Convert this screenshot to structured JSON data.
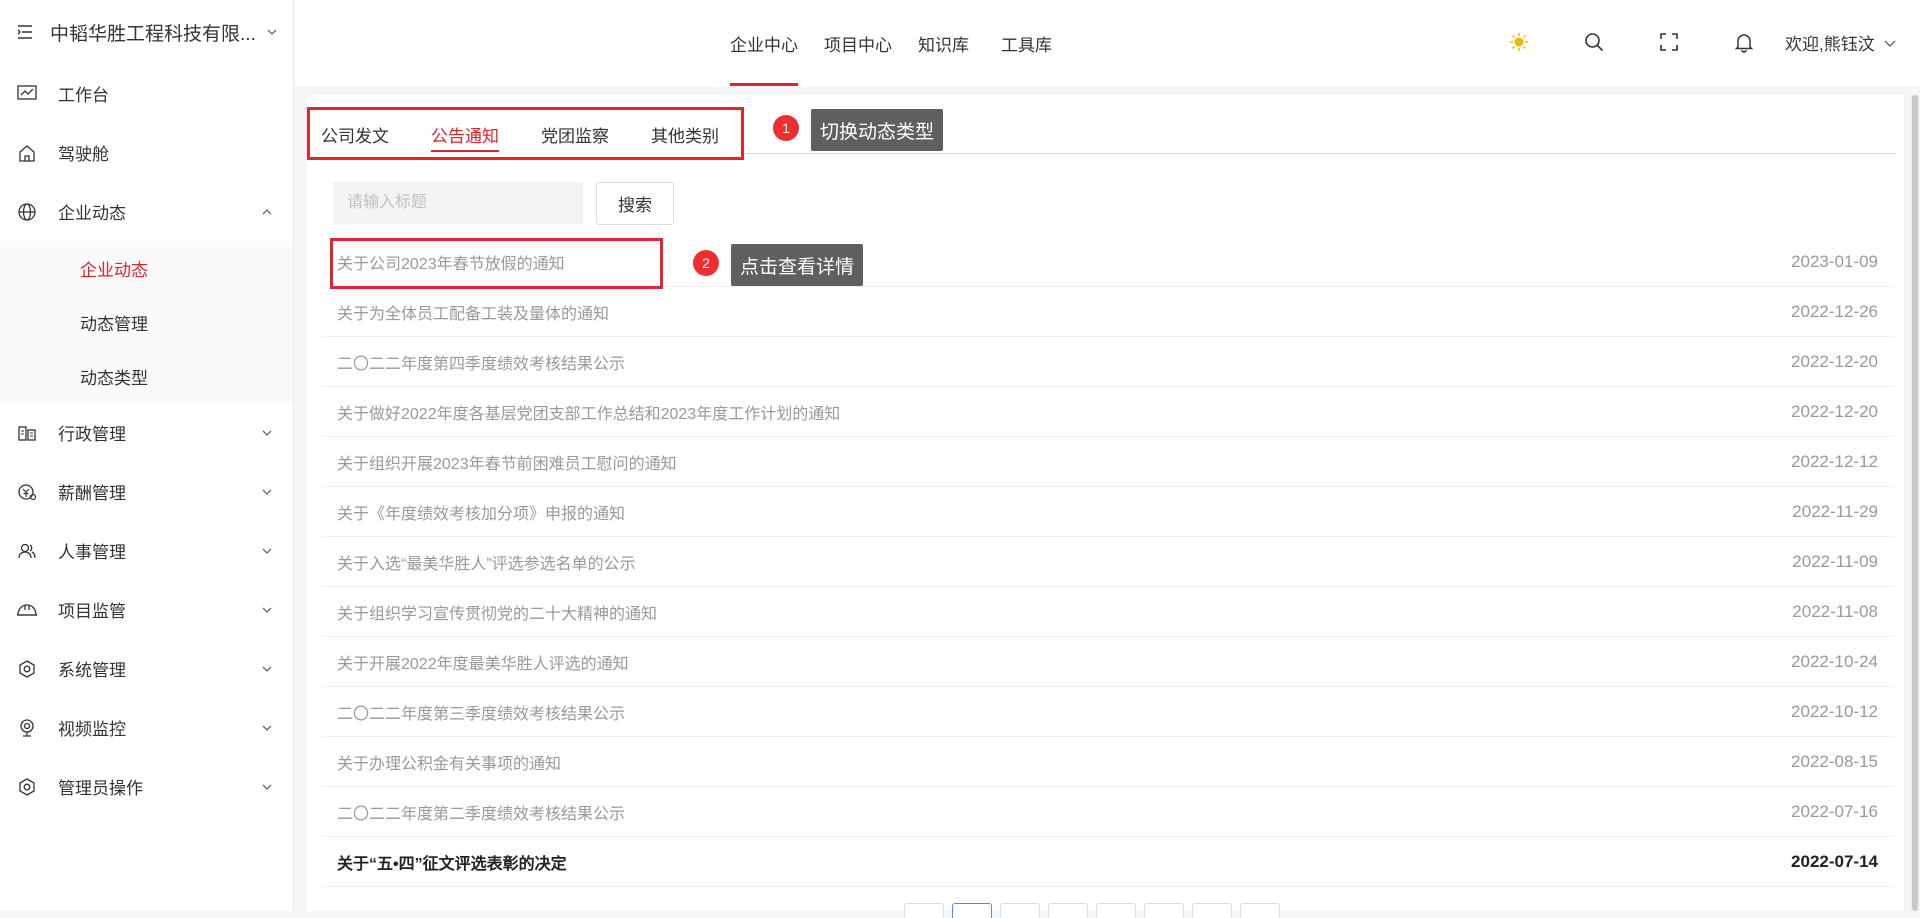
{
  "sidebar": {
    "company": "中韬华胜工程科技有限...",
    "items": [
      {
        "label": "工作台",
        "icon": "monitor-chart-icon"
      },
      {
        "label": "驾驶舱",
        "icon": "home-icon"
      },
      {
        "label": "企业动态",
        "icon": "globe-icon",
        "expanded": true
      }
    ],
    "sub_items": [
      {
        "label": "企业动态",
        "active": true
      },
      {
        "label": "动态管理"
      },
      {
        "label": "动态类型"
      }
    ],
    "items_after": [
      {
        "label": "行政管理",
        "icon": "building-icon"
      },
      {
        "label": "薪酬管理",
        "icon": "salary-icon"
      },
      {
        "label": "人事管理",
        "icon": "people-icon"
      },
      {
        "label": "项目监管",
        "icon": "helmet-icon"
      },
      {
        "label": "系统管理",
        "icon": "gear-icon"
      },
      {
        "label": "视频监控",
        "icon": "camera-icon"
      },
      {
        "label": "管理员操作",
        "icon": "gear-icon"
      }
    ]
  },
  "topnav": {
    "items": [
      {
        "label": "企业中心",
        "active": true
      },
      {
        "label": "项目中心"
      },
      {
        "label": "知识库"
      },
      {
        "label": "工具库"
      }
    ],
    "welcome": "欢迎,熊钰汶"
  },
  "tabs": [
    {
      "label": "公司发文"
    },
    {
      "label": "公告通知",
      "active": true
    },
    {
      "label": "党团监察"
    },
    {
      "label": "其他类别"
    }
  ],
  "annotations": {
    "one_num": "1",
    "one_text": "切换动态类型",
    "two_num": "2",
    "two_text": "点击查看详情"
  },
  "search": {
    "placeholder": "请输入标题",
    "button": "搜索"
  },
  "notices": [
    {
      "title": "关于公司2023年春节放假的通知",
      "date": "2023-01-09"
    },
    {
      "title": "关于为全体员工配备工装及量体的通知",
      "date": "2022-12-26"
    },
    {
      "title": "二〇二二年度第四季度绩效考核结果公示",
      "date": "2022-12-20"
    },
    {
      "title": "关于做好2022年度各基层党团支部工作总结和2023年度工作计划的通知",
      "date": "2022-12-20"
    },
    {
      "title": "关于组织开展2023年春节前困难员工慰问的通知",
      "date": "2022-12-12"
    },
    {
      "title": "关于《年度绩效考核加分项》申报的通知",
      "date": "2022-11-29"
    },
    {
      "title": "关于入选“最美华胜人”评选参选名单的公示",
      "date": "2022-11-09"
    },
    {
      "title": "关于组织学习宣传贯彻党的二十大精神的通知",
      "date": "2022-11-08"
    },
    {
      "title": "关于开展2022年度最美华胜人评选的通知",
      "date": "2022-10-24"
    },
    {
      "title": "二〇二二年度第三季度绩效考核结果公示",
      "date": "2022-10-12"
    },
    {
      "title": "关于办理公积金有关事项的通知",
      "date": "2022-08-15"
    },
    {
      "title": "二〇二二年度第二季度绩效考核结果公示",
      "date": "2022-07-16"
    },
    {
      "title": "关于“五•四”征文评选表彰的决定",
      "date": "2022-07-14",
      "bold": true
    }
  ],
  "colors": {
    "accent": "#d9262b",
    "annotation_red": "#ef2f2f",
    "tooltip_bg": "#5f5f5f"
  }
}
